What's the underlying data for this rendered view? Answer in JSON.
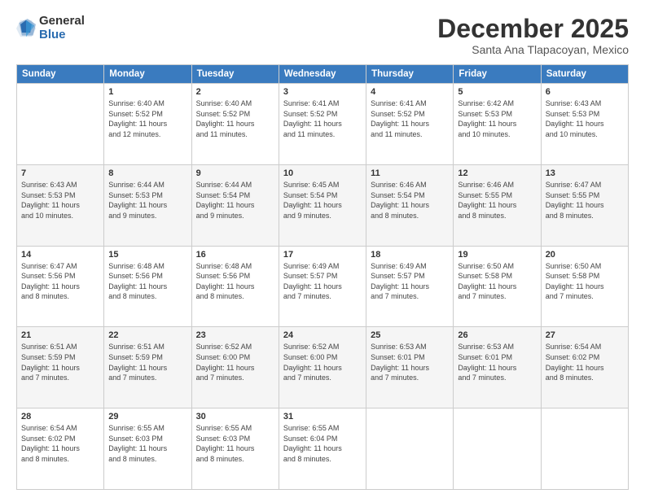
{
  "logo": {
    "general": "General",
    "blue": "Blue"
  },
  "title": "December 2025",
  "subtitle": "Santa Ana Tlapacoyan, Mexico",
  "header_days": [
    "Sunday",
    "Monday",
    "Tuesday",
    "Wednesday",
    "Thursday",
    "Friday",
    "Saturday"
  ],
  "weeks": [
    [
      {
        "day": "",
        "info": ""
      },
      {
        "day": "1",
        "info": "Sunrise: 6:40 AM\nSunset: 5:52 PM\nDaylight: 11 hours\nand 12 minutes."
      },
      {
        "day": "2",
        "info": "Sunrise: 6:40 AM\nSunset: 5:52 PM\nDaylight: 11 hours\nand 11 minutes."
      },
      {
        "day": "3",
        "info": "Sunrise: 6:41 AM\nSunset: 5:52 PM\nDaylight: 11 hours\nand 11 minutes."
      },
      {
        "day": "4",
        "info": "Sunrise: 6:41 AM\nSunset: 5:52 PM\nDaylight: 11 hours\nand 11 minutes."
      },
      {
        "day": "5",
        "info": "Sunrise: 6:42 AM\nSunset: 5:53 PM\nDaylight: 11 hours\nand 10 minutes."
      },
      {
        "day": "6",
        "info": "Sunrise: 6:43 AM\nSunset: 5:53 PM\nDaylight: 11 hours\nand 10 minutes."
      }
    ],
    [
      {
        "day": "7",
        "info": "Sunrise: 6:43 AM\nSunset: 5:53 PM\nDaylight: 11 hours\nand 10 minutes."
      },
      {
        "day": "8",
        "info": "Sunrise: 6:44 AM\nSunset: 5:53 PM\nDaylight: 11 hours\nand 9 minutes."
      },
      {
        "day": "9",
        "info": "Sunrise: 6:44 AM\nSunset: 5:54 PM\nDaylight: 11 hours\nand 9 minutes."
      },
      {
        "day": "10",
        "info": "Sunrise: 6:45 AM\nSunset: 5:54 PM\nDaylight: 11 hours\nand 9 minutes."
      },
      {
        "day": "11",
        "info": "Sunrise: 6:46 AM\nSunset: 5:54 PM\nDaylight: 11 hours\nand 8 minutes."
      },
      {
        "day": "12",
        "info": "Sunrise: 6:46 AM\nSunset: 5:55 PM\nDaylight: 11 hours\nand 8 minutes."
      },
      {
        "day": "13",
        "info": "Sunrise: 6:47 AM\nSunset: 5:55 PM\nDaylight: 11 hours\nand 8 minutes."
      }
    ],
    [
      {
        "day": "14",
        "info": "Sunrise: 6:47 AM\nSunset: 5:56 PM\nDaylight: 11 hours\nand 8 minutes."
      },
      {
        "day": "15",
        "info": "Sunrise: 6:48 AM\nSunset: 5:56 PM\nDaylight: 11 hours\nand 8 minutes."
      },
      {
        "day": "16",
        "info": "Sunrise: 6:48 AM\nSunset: 5:56 PM\nDaylight: 11 hours\nand 8 minutes."
      },
      {
        "day": "17",
        "info": "Sunrise: 6:49 AM\nSunset: 5:57 PM\nDaylight: 11 hours\nand 7 minutes."
      },
      {
        "day": "18",
        "info": "Sunrise: 6:49 AM\nSunset: 5:57 PM\nDaylight: 11 hours\nand 7 minutes."
      },
      {
        "day": "19",
        "info": "Sunrise: 6:50 AM\nSunset: 5:58 PM\nDaylight: 11 hours\nand 7 minutes."
      },
      {
        "day": "20",
        "info": "Sunrise: 6:50 AM\nSunset: 5:58 PM\nDaylight: 11 hours\nand 7 minutes."
      }
    ],
    [
      {
        "day": "21",
        "info": "Sunrise: 6:51 AM\nSunset: 5:59 PM\nDaylight: 11 hours\nand 7 minutes."
      },
      {
        "day": "22",
        "info": "Sunrise: 6:51 AM\nSunset: 5:59 PM\nDaylight: 11 hours\nand 7 minutes."
      },
      {
        "day": "23",
        "info": "Sunrise: 6:52 AM\nSunset: 6:00 PM\nDaylight: 11 hours\nand 7 minutes."
      },
      {
        "day": "24",
        "info": "Sunrise: 6:52 AM\nSunset: 6:00 PM\nDaylight: 11 hours\nand 7 minutes."
      },
      {
        "day": "25",
        "info": "Sunrise: 6:53 AM\nSunset: 6:01 PM\nDaylight: 11 hours\nand 7 minutes."
      },
      {
        "day": "26",
        "info": "Sunrise: 6:53 AM\nSunset: 6:01 PM\nDaylight: 11 hours\nand 7 minutes."
      },
      {
        "day": "27",
        "info": "Sunrise: 6:54 AM\nSunset: 6:02 PM\nDaylight: 11 hours\nand 8 minutes."
      }
    ],
    [
      {
        "day": "28",
        "info": "Sunrise: 6:54 AM\nSunset: 6:02 PM\nDaylight: 11 hours\nand 8 minutes."
      },
      {
        "day": "29",
        "info": "Sunrise: 6:55 AM\nSunset: 6:03 PM\nDaylight: 11 hours\nand 8 minutes."
      },
      {
        "day": "30",
        "info": "Sunrise: 6:55 AM\nSunset: 6:03 PM\nDaylight: 11 hours\nand 8 minutes."
      },
      {
        "day": "31",
        "info": "Sunrise: 6:55 AM\nSunset: 6:04 PM\nDaylight: 11 hours\nand 8 minutes."
      },
      {
        "day": "",
        "info": ""
      },
      {
        "day": "",
        "info": ""
      },
      {
        "day": "",
        "info": ""
      }
    ]
  ]
}
